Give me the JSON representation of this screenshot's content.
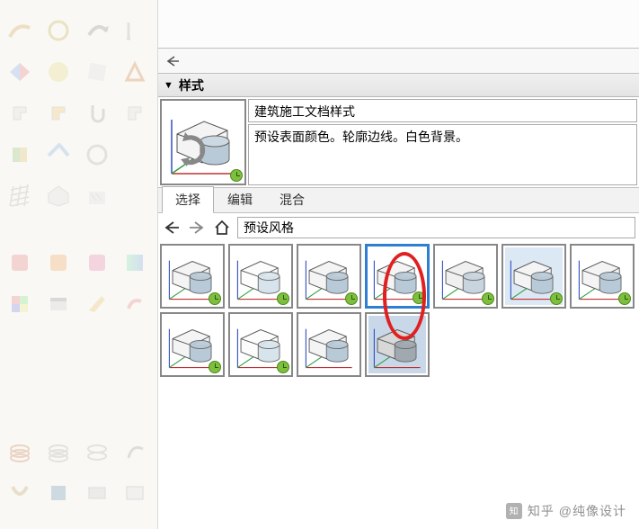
{
  "panel": {
    "title": "样式"
  },
  "style": {
    "name": "建筑施工文档样式",
    "description": "预设表面颜色。轮廓边线。白色背景。"
  },
  "tabs": {
    "select": "选择",
    "edit": "编辑",
    "mix": "混合",
    "active": 0
  },
  "browser": {
    "path": "预设风格"
  },
  "thumbs": {
    "count": 11,
    "selected_index": 3,
    "clock_badge_until": 9
  },
  "icons": {
    "back": "back-arrow",
    "forward": "forward-arrow",
    "home": "home"
  },
  "watermark": {
    "text": "知乎 @纯像设计"
  },
  "annotation": {
    "shape": "ellipse",
    "color": "#e02020"
  }
}
